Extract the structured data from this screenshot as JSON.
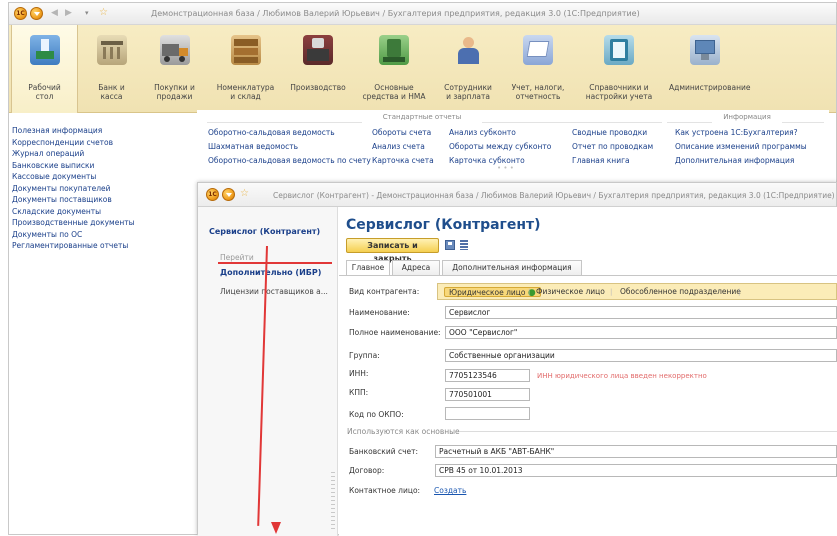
{
  "main_window": {
    "logo_text": "1С",
    "title": "Демонстрационная база / Любимов Валерий Юрьевич / Бухгалтерия предприятия, редакция 3.0  (1С:Предприятие)"
  },
  "sections": [
    {
      "label": "Рабочий\nстол",
      "icon": "desktop-icon"
    },
    {
      "label": "Банк и\nкасса",
      "icon": "bank-icon"
    },
    {
      "label": "Покупки и\nпродажи",
      "icon": "truck-icon"
    },
    {
      "label": "Номенклатура\nи склад",
      "icon": "warehouse-icon"
    },
    {
      "label": "Производство",
      "icon": "production-icon"
    },
    {
      "label": "Основные\nсредства и НМА",
      "icon": "assets-icon"
    },
    {
      "label": "Сотрудники\nи зарплата",
      "icon": "employees-icon"
    },
    {
      "label": "Учет, налоги,\nотчетность",
      "icon": "accounting-icon"
    },
    {
      "label": "Справочники и\nнастройки учета",
      "icon": "reference-icon"
    },
    {
      "label": "Администрирование",
      "icon": "admin-icon"
    }
  ],
  "left_nav": [
    "Полезная информация",
    "Корреспонденции счетов",
    "Журнал операций",
    "Банковские выписки",
    "Кассовые документы",
    "Документы покупателей",
    "Документы поставщиков",
    "Складские документы",
    "Производственные документы",
    "Документы по ОС",
    "Регламентированные отчеты"
  ],
  "reports": {
    "standard_header": "Стандартные отчеты",
    "info_header": "Информация",
    "col1": [
      "Оборотно-сальдовая ведомость",
      "Шахматная ведомость",
      "Оборотно-сальдовая ведомость по счету"
    ],
    "col2": [
      "Обороты счета",
      "Анализ счета",
      "Карточка счета"
    ],
    "col3": [
      "Анализ субконто",
      "Обороты между субконто",
      "Карточка субконто"
    ],
    "col4": [
      "Сводные проводки",
      "Отчет по проводкам",
      "Главная книга"
    ],
    "col5": [
      "Как устроена 1С:Бухгалтерия?",
      "Описание изменений программы",
      "Дополнительная информация"
    ]
  },
  "inner_window": {
    "logo_text": "1С",
    "title": "Сервислог (Контрагент) - Демонстрационная база / Любимов Валерий Юрьевич / Бухгалтерия предприятия, редакция 3.0  (1С:Предприятие)",
    "nav": {
      "object_title": "Сервислог (Контрагент)",
      "go_label": "Перейти",
      "additional": "Дополнительно (ИБР)",
      "licenses": "Лицензии поставщиков а..."
    }
  },
  "form": {
    "title": "Сервислог (Контрагент)",
    "save_close": "Записать и закрыть",
    "tabs": [
      "Главное",
      "Адреса",
      "Дополнительная информация"
    ],
    "kind_label": "Вид контрагента:",
    "kind_options": [
      "Юридическое лицо",
      "Физическое лицо",
      "Обособленное подразделение"
    ],
    "name_label": "Наименование:",
    "name_value": "Сервислог",
    "fullname_label": "Полное наименование:",
    "fullname_value": "ООО \"Сервислог\"",
    "group_label": "Группа:",
    "group_value": "Собственные организации",
    "inn_label": "ИНН:",
    "inn_value": "7705123546",
    "inn_warning": "ИНН юридического лица введен некорректно",
    "kpp_label": "КПП:",
    "kpp_value": "770501001",
    "okpo_label": "Код по ОКПО:",
    "okpo_value": "",
    "defaults_heading": "Используются как основные",
    "bank_label": "Банковский счет:",
    "bank_value": "Расчетный в АКБ \"АВТ-БАНК\"",
    "contract_label": "Договор:",
    "contract_value": "СРВ 45 от 10.01.2013",
    "contact_label": "Контактное лицо:",
    "contact_link": "Создать"
  },
  "colors": {
    "accent_red": "#e13737",
    "section_bg": "#f0e2b2",
    "title_blue": "#1f4e8c",
    "button_yellow": "#f5cf50"
  }
}
